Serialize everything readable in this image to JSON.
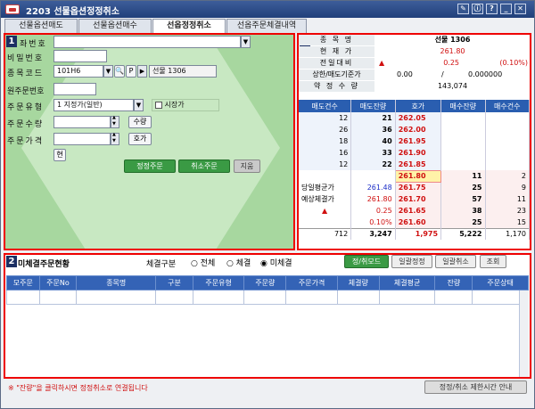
{
  "window": {
    "title": "2203 선물옵션정정취소",
    "icon": "app-logo-icon",
    "buttons": [
      "pin",
      "ⓘ",
      "?",
      "⊟",
      "✕"
    ]
  },
  "tabs": [
    {
      "label": "선물옵션매도",
      "active": false
    },
    {
      "label": "선물옵션매수",
      "active": false
    },
    {
      "label": "선옵정정취소",
      "active": true
    },
    {
      "label": "선옵주문체결내역",
      "active": false
    }
  ],
  "order_form": {
    "badge": "1",
    "account_label": "좌번호",
    "password_label": "비밀번호",
    "code_label": "종목코드",
    "code_value": "101H6",
    "code_name": "선물 1306",
    "p_button": "P",
    "original_order_label": "원주문번호",
    "order_type_label": "주문유형",
    "order_type_value": "1 지정가(일반)",
    "market_price_label": "시장가",
    "qty_label": "주문수량",
    "qty_button": "수량",
    "price_label": "주문가격",
    "price_button": "호가",
    "current_button": "현",
    "amend_button": "정정주문",
    "cancel_button": "취소주문",
    "clear_button": "지움"
  },
  "quote_panel": {
    "badge": "3",
    "name_key": "종 목 명",
    "name_value": "선물 1306",
    "price_key": "현 재 가",
    "price_value": "261.80",
    "change_key": "전일대비",
    "change_value": "0.25",
    "change_pct": "(0.10%)",
    "upper_key": "상한/매도기준가",
    "upper_value": "0.00",
    "upper_sep": "/",
    "upper_value2": "0.000000",
    "volume_key": "약 정 수 량",
    "volume_value": "143,074"
  },
  "orderbook": {
    "headers": [
      "매도건수",
      "매도잔량",
      "호가",
      "매수잔량",
      "매수건수"
    ],
    "asks": [
      {
        "cnt": "12",
        "qty": "21",
        "price": "262.05"
      },
      {
        "cnt": "26",
        "qty": "36",
        "price": "262.00"
      },
      {
        "cnt": "18",
        "qty": "40",
        "price": "261.95"
      },
      {
        "cnt": "16",
        "qty": "33",
        "price": "261.90"
      },
      {
        "cnt": "12",
        "qty": "22",
        "price": "261.85"
      }
    ],
    "bids": [
      {
        "left_label": "",
        "left_value": "",
        "price": "261.80",
        "qty": "11",
        "cnt": "2"
      },
      {
        "left_label": "당일평균가",
        "left_value": "261.48",
        "price": "261.75",
        "qty": "25",
        "cnt": "9"
      },
      {
        "left_label": "예상체결가",
        "left_value": "261.80",
        "price": "261.70",
        "qty": "57",
        "cnt": "11"
      },
      {
        "left_label": "▲",
        "left_value": "0.25",
        "price": "261.65",
        "qty": "38",
        "cnt": "23"
      },
      {
        "left_label": "",
        "left_value": "0.10%",
        "price": "261.60",
        "qty": "25",
        "cnt": "15"
      }
    ],
    "totals": {
      "ask_cnt": "712",
      "ask_qty": "3,247",
      "diff": "1,975",
      "bid_qty": "5,222",
      "bid_cnt": "1,170"
    }
  },
  "unfilled": {
    "badge": "2",
    "title": "미체결주문현황",
    "filter_label": "체결구분",
    "filter_options": [
      "전체",
      "체결",
      "미체결"
    ],
    "filter_selected": "미체결",
    "mode_button": "정/취모드",
    "bulk_amend_button": "일괄정정",
    "bulk_cancel_button": "일괄취소",
    "query_button": "조회",
    "columns": [
      "모주문",
      "주문No",
      "종목명",
      "구분",
      "주문유형",
      "주문량",
      "주문가격",
      "체결량",
      "체결평균",
      "잔량",
      "주문상태"
    ]
  },
  "footer": {
    "notice": "※ \"잔량\"을 클릭하시면 정정취소로 연결됩니다",
    "time_button": "정정/취소 제한시간 안내"
  }
}
